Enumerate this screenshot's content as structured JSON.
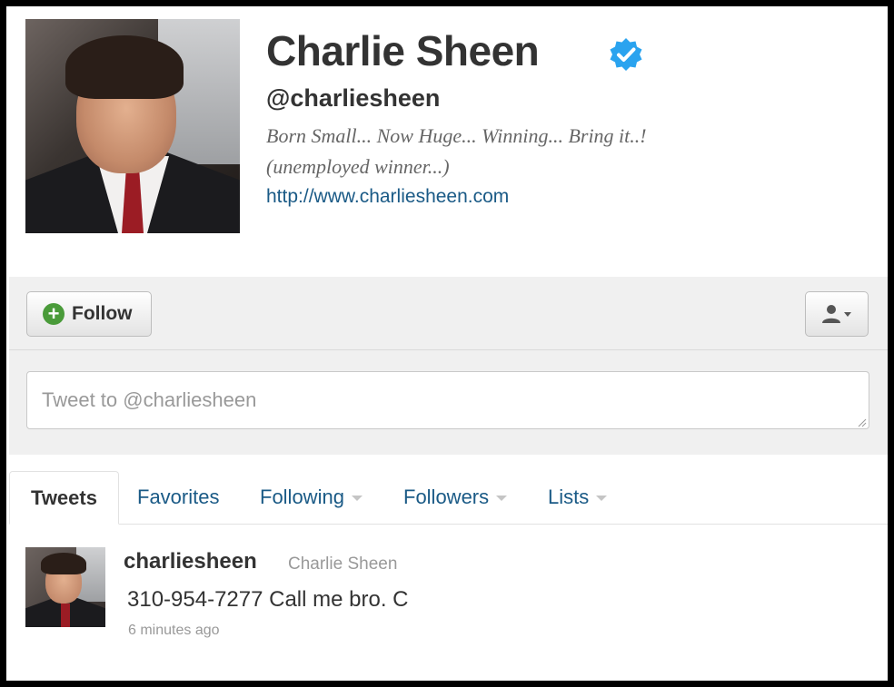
{
  "profile": {
    "name": "Charlie Sheen",
    "handle": "@charliesheen",
    "bio_line1": "Born Small... Now Huge... Winning... Bring it..!",
    "bio_line2": "(unemployed winner...)",
    "url": "http://www.charliesheen.com",
    "verified_color": "#2aa3ef"
  },
  "actions": {
    "follow_label": "Follow",
    "tweet_placeholder": "Tweet to @charliesheen"
  },
  "tabs": [
    {
      "label": "Tweets",
      "active": true
    },
    {
      "label": "Favorites"
    },
    {
      "label": "Following",
      "dropdown": true
    },
    {
      "label": "Followers",
      "dropdown": true
    },
    {
      "label": "Lists",
      "dropdown": true
    }
  ],
  "tweet": {
    "screen_name": "charliesheen",
    "full_name": "Charlie Sheen",
    "text": "310-954-7277 Call me bro. C",
    "timestamp": "6 minutes ago"
  }
}
